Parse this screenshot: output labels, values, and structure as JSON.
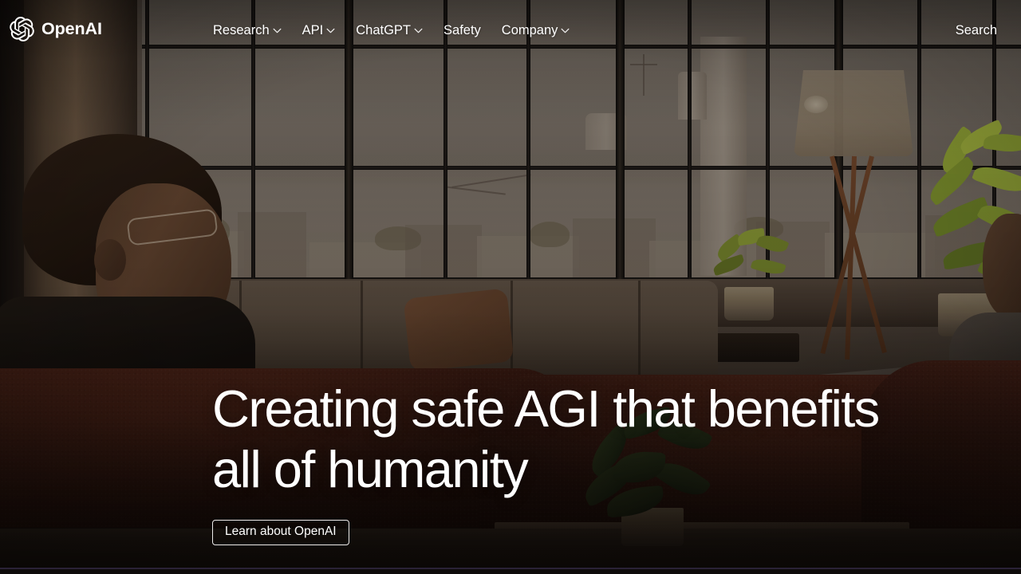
{
  "brand": {
    "name": "OpenAI",
    "logo_icon": "openai-blossom-logo"
  },
  "nav": {
    "items": [
      {
        "label": "Research",
        "has_dropdown": true,
        "icon": "chevron-down-icon"
      },
      {
        "label": "API",
        "has_dropdown": true,
        "icon": "chevron-down-icon"
      },
      {
        "label": "ChatGPT",
        "has_dropdown": true,
        "icon": "chevron-down-icon"
      },
      {
        "label": "Safety",
        "has_dropdown": false,
        "icon": ""
      },
      {
        "label": "Company",
        "has_dropdown": true,
        "icon": "chevron-down-icon"
      }
    ],
    "search_label": "Search"
  },
  "hero": {
    "headline_line1": "Creating safe AGI that benefits",
    "headline_line2": "all of humanity",
    "cta_label": "Learn about OpenAI",
    "background_description": "Two people seated on rust-colored boucle sofas in a loft with tall black-framed industrial windows, a tripod floor lamp, and potted plants",
    "text_color": "#ffffff",
    "overlay_tint": "#1c140e"
  }
}
